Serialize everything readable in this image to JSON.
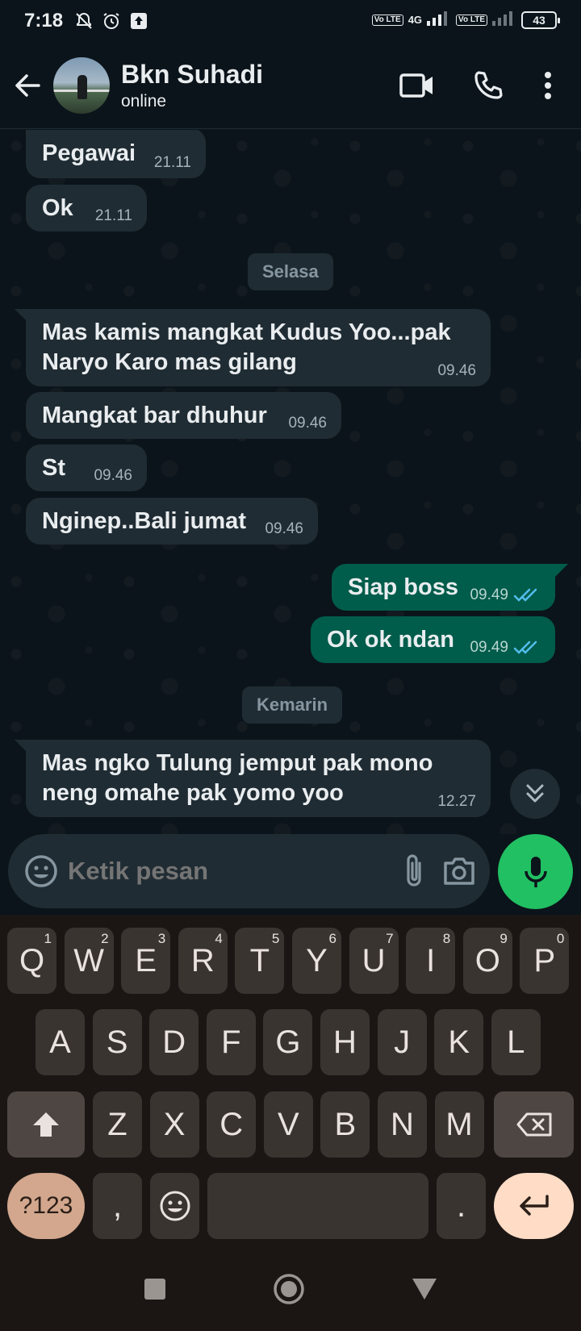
{
  "status_bar": {
    "time": "7:18",
    "net_type": "4G",
    "volte1": "Vo LTE",
    "volte2": "Vo LTE",
    "battery": "43"
  },
  "header": {
    "contact_name": "Bkn Suhadi",
    "contact_status": "online"
  },
  "messages": [
    {
      "type": "in",
      "text": "Pegawai",
      "time": "21.11"
    },
    {
      "type": "in",
      "text": "Ok",
      "time": "21.11"
    },
    {
      "type": "day",
      "text": "Selasa"
    },
    {
      "type": "in",
      "text": "Mas kamis mangkat Kudus Yoo...pak Naryo Karo mas gilang",
      "line1": "Mas kamis mangkat Kudus Yoo...pak",
      "line2": "Naryo Karo mas gilang",
      "time": "09.46"
    },
    {
      "type": "in",
      "text": "Mangkat bar dhuhur",
      "time": "09.46"
    },
    {
      "type": "in",
      "text": "St",
      "time": "09.46"
    },
    {
      "type": "in",
      "text": "Nginep..Bali jumat",
      "time": "09.46"
    },
    {
      "type": "out",
      "text": "Siap boss",
      "time": "09.49"
    },
    {
      "type": "out",
      "text": "Ok ok ndan",
      "time": "09.49"
    },
    {
      "type": "day",
      "text": "Kemarin"
    },
    {
      "type": "in",
      "text": "Mas ngko Tulung jemput pak mono neng omahe pak yomo yoo",
      "line1": "Mas ngko Tulung jemput pak mono",
      "line2": "neng omahe pak yomo yoo",
      "time": "12.27"
    }
  ],
  "composer": {
    "placeholder": "Ketik pesan"
  },
  "keyboard": {
    "row1": [
      [
        "Q",
        "1"
      ],
      [
        "W",
        "2"
      ],
      [
        "E",
        "3"
      ],
      [
        "R",
        "4"
      ],
      [
        "T",
        "5"
      ],
      [
        "Y",
        "6"
      ],
      [
        "U",
        "7"
      ],
      [
        "I",
        "8"
      ],
      [
        "O",
        "9"
      ],
      [
        "P",
        "0"
      ]
    ],
    "row2": [
      "A",
      "S",
      "D",
      "F",
      "G",
      "H",
      "J",
      "K",
      "L"
    ],
    "row3": [
      "Z",
      "X",
      "C",
      "V",
      "B",
      "N",
      "M"
    ],
    "symbols_key": "?123",
    "comma_key": ",",
    "period_key": "."
  },
  "colors": {
    "incoming_bubble": "#202c33",
    "outgoing_bubble": "#005c4b",
    "read_ticks": "#53bdeb",
    "mic_button": "#21c063"
  }
}
